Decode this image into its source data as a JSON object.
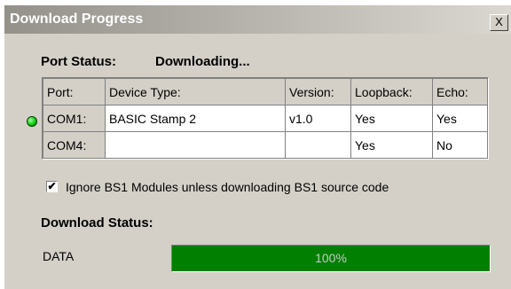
{
  "window": {
    "title": "Download Progress",
    "close_symbol": "X"
  },
  "port_status": {
    "label": "Port Status:",
    "value": "Downloading..."
  },
  "ports_table": {
    "headers": [
      "Port:",
      "Device Type:",
      "Version:",
      "Loopback:",
      "Echo:"
    ],
    "rows": [
      {
        "active": true,
        "port": "COM1:",
        "device_type": "BASIC Stamp 2",
        "version": "v1.0",
        "loopback": "Yes",
        "echo": "Yes"
      },
      {
        "active": false,
        "port": "COM4:",
        "device_type": "",
        "version": "",
        "loopback": "Yes",
        "echo": "No"
      }
    ],
    "active_indicator_color": "#00c800"
  },
  "ignore_bs1": {
    "checked": true,
    "label": "Ignore BS1 Modules unless downloading BS1 source code"
  },
  "download_status": {
    "label": "Download Status:",
    "stream_label": "DATA",
    "progress_percent": 100,
    "progress_text": "100%",
    "bar_color": "#007f00"
  }
}
